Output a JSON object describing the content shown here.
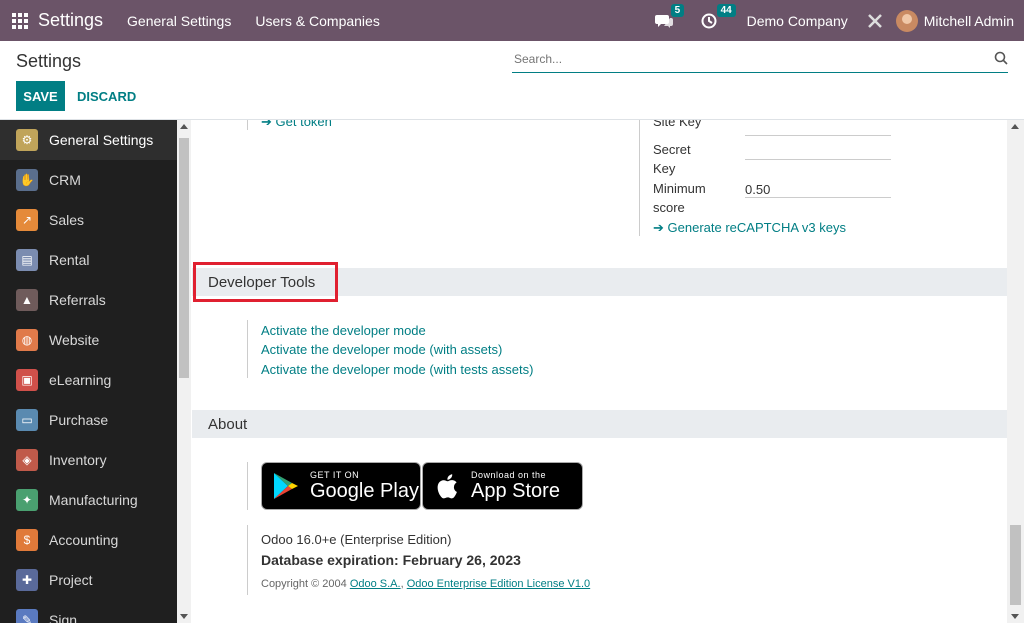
{
  "navbar": {
    "brand": "Settings",
    "menu": [
      "General Settings",
      "Users & Companies"
    ],
    "messages_count": "5",
    "activities_count": "44",
    "company": "Demo Company",
    "user": "Mitchell Admin",
    "color": "#6b5468"
  },
  "control": {
    "title": "Settings",
    "search_placeholder": "Search...",
    "save_label": "SAVE",
    "discard_label": "DISCARD"
  },
  "sidebar": {
    "items": [
      {
        "label": "General Settings",
        "icon": "gear-icon",
        "color": "#c0a45a"
      },
      {
        "label": "CRM",
        "icon": "handshake-icon",
        "color": "#5a6e8c"
      },
      {
        "label": "Sales",
        "icon": "chart-icon",
        "color": "#e58a3a"
      },
      {
        "label": "Rental",
        "icon": "rental-icon",
        "color": "#7b8cb0"
      },
      {
        "label": "Referrals",
        "icon": "referrals-icon",
        "color": "#6f5b5b"
      },
      {
        "label": "Website",
        "icon": "globe-icon",
        "color": "#e07a4a"
      },
      {
        "label": "eLearning",
        "icon": "elearning-icon",
        "color": "#d0504a"
      },
      {
        "label": "Purchase",
        "icon": "purchase-icon",
        "color": "#5a8ab0"
      },
      {
        "label": "Inventory",
        "icon": "box-icon",
        "color": "#c05a4a"
      },
      {
        "label": "Manufacturing",
        "icon": "wrench-icon",
        "color": "#4aa070"
      },
      {
        "label": "Accounting",
        "icon": "accounting-icon",
        "color": "#e07a3a"
      },
      {
        "label": "Project",
        "icon": "puzzle-icon",
        "color": "#5a6a9a"
      },
      {
        "label": "Sign",
        "icon": "sign-icon",
        "color": "#5a7ac0"
      }
    ]
  },
  "recaptcha": {
    "get_token": "Get token",
    "site_key": "Site Key",
    "secret_key_1": "Secret",
    "secret_key_2": "Key",
    "min_score_1": "Minimum",
    "min_score_2": "score",
    "min_score_value": "0.50",
    "generate": "Generate reCAPTCHA v3 keys"
  },
  "developer_tools": {
    "title": "Developer Tools",
    "links": [
      "Activate the developer mode",
      "Activate the developer mode (with assets)",
      "Activate the developer mode (with tests assets)"
    ]
  },
  "about": {
    "title": "About",
    "google_small": "GET IT ON",
    "google_big": "Google Play",
    "apple_small": "Download on the",
    "apple_big": "App Store",
    "version": "Odoo 16.0+e (Enterprise Edition)",
    "expiration": "Database expiration: February 26, 2023",
    "copyright_prefix": "Copyright © 2004",
    "copyright_link1": "Odoo S.A.",
    "copyright_link2": "Odoo Enterprise Edition License V1.0"
  }
}
